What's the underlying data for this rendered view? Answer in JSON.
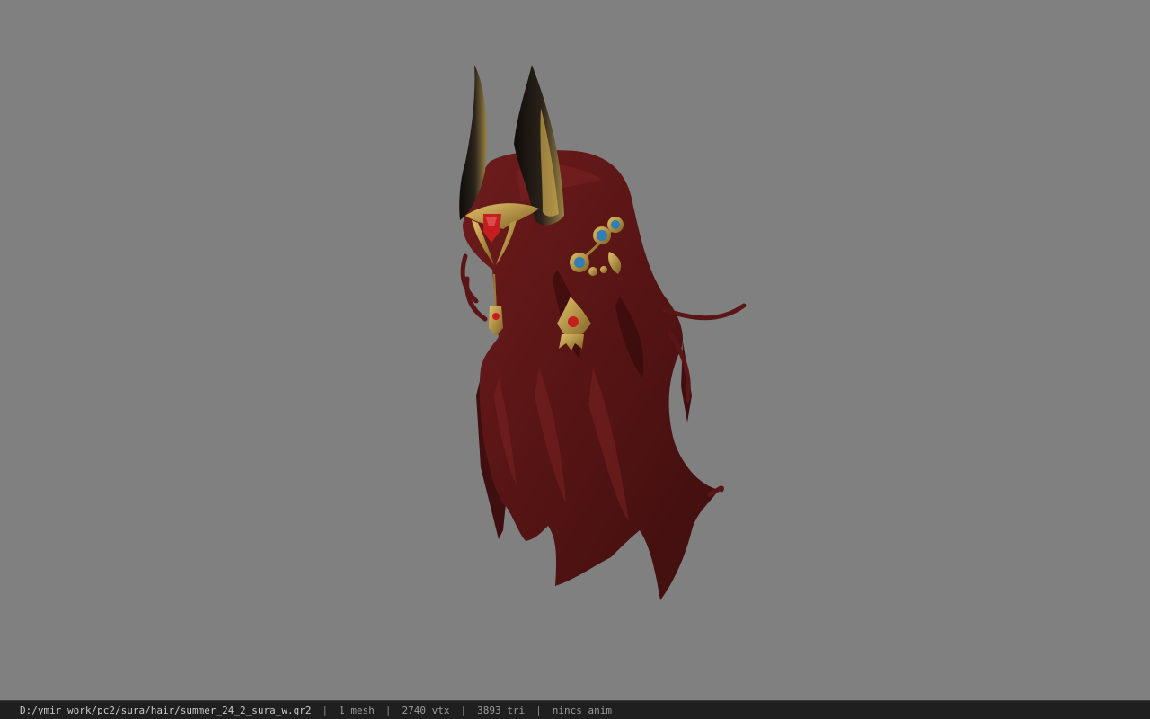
{
  "viewer": {
    "background_color": "#808080",
    "model": {
      "name": "hair-model",
      "hair_color": "#5a1414",
      "horn_color": "#1a1410",
      "gold_color": "#b8953a",
      "gem_color": "#c41e1e",
      "stone_color": "#2f7fb5"
    }
  },
  "status": {
    "file_path": "D:/ymir work/pc2/sura/hair/summer_24_2_sura_w.gr2",
    "mesh_count": "1 mesh",
    "vertex_count": "2740 vtx",
    "triangle_count": "3893 tri",
    "animation": "nincs anim",
    "separator": "|"
  }
}
